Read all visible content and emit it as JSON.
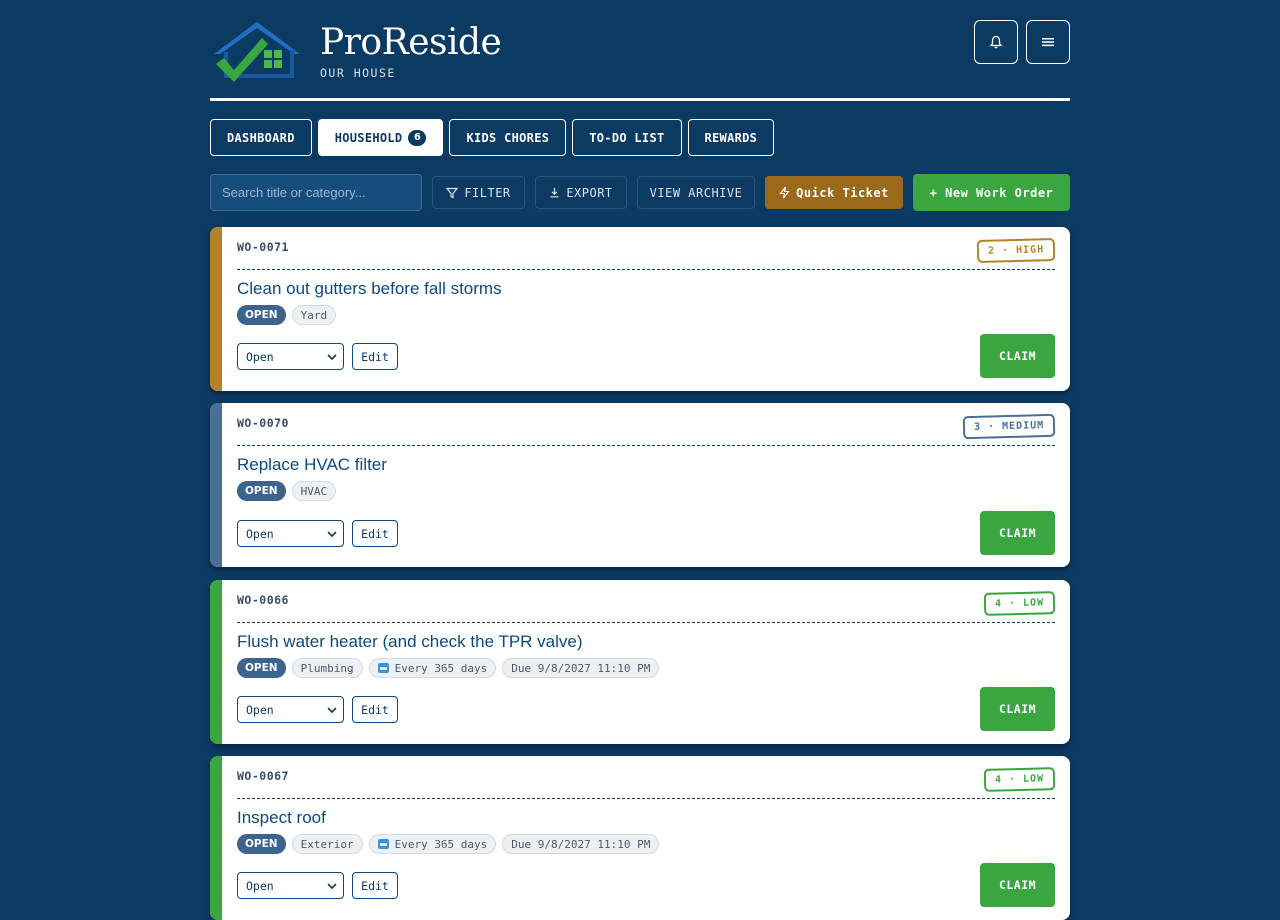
{
  "brand": {
    "title": "ProReside",
    "subtitle": "OUR HOUSE"
  },
  "header_buttons": {
    "bell": "bell-icon",
    "menu": "hamburger-icon"
  },
  "tabs": [
    {
      "label": "DASHBOARD",
      "active": false
    },
    {
      "label": "HOUSEHOLD",
      "active": true,
      "badge": "6"
    },
    {
      "label": "KIDS CHORES",
      "active": false
    },
    {
      "label": "TO-DO LIST",
      "active": false
    },
    {
      "label": "REWARDS",
      "active": false
    }
  ],
  "toolbar": {
    "search_placeholder": "Search title or category...",
    "filter_label": "FILTER",
    "export_label": "EXPORT",
    "archive_label": "VIEW ARCHIVE",
    "quick_label": "Quick Ticket",
    "new_label": "+ New Work Order"
  },
  "colors": {
    "background": "#0b3a63",
    "high": "#b5822a",
    "medium": "#4a6f96",
    "low": "#3aa63f",
    "claim": "#3aa63f",
    "quick": "#9a6a1a"
  },
  "work_orders": [
    {
      "id": "WO-0071",
      "priority": "2 · HIGH",
      "title": "Clean out gutters before fall storms",
      "status": "OPEN",
      "category": "Yard",
      "recurrence": "",
      "due": "",
      "select_value": "Open",
      "edit_label": "Edit",
      "claim_label": "CLAIM"
    },
    {
      "id": "WO-0070",
      "priority": "3 · MEDIUM",
      "title": "Replace HVAC filter",
      "status": "OPEN",
      "category": "HVAC",
      "recurrence": "",
      "due": "",
      "select_value": "Open",
      "edit_label": "Edit",
      "claim_label": "CLAIM"
    },
    {
      "id": "WO-0066",
      "priority": "4 · LOW",
      "title": "Flush water heater (and check the TPR valve)",
      "status": "OPEN",
      "category": "Plumbing",
      "recurrence": "Every 365 days",
      "due": "Due 9/8/2027 11:10 PM",
      "select_value": "Open",
      "edit_label": "Edit",
      "claim_label": "CLAIM"
    },
    {
      "id": "WO-0067",
      "priority": "4 · LOW",
      "title": "Inspect roof",
      "status": "OPEN",
      "category": "Exterior",
      "recurrence": "Every 365 days",
      "due": "Due 9/8/2027 11:10 PM",
      "select_value": "Open",
      "edit_label": "Edit",
      "claim_label": "CLAIM"
    }
  ]
}
